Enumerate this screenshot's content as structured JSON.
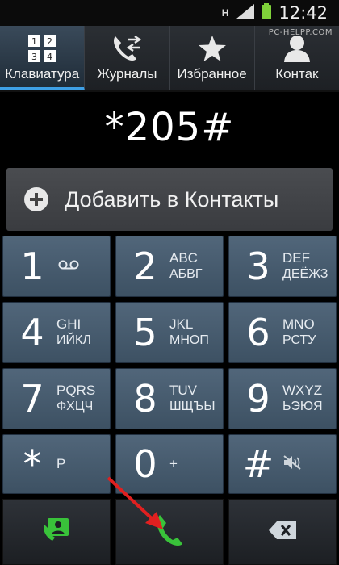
{
  "status": {
    "h_label": "H",
    "time": "12:42"
  },
  "watermark": "PC-HELPP.COM",
  "tabs": [
    {
      "label": "Клавиатура",
      "icon": "keypad-icon",
      "active": true
    },
    {
      "label": "Журналы",
      "icon": "call-log-icon"
    },
    {
      "label": "Избранное",
      "icon": "star-icon"
    },
    {
      "label": "Контак",
      "icon": "contact-person-icon"
    }
  ],
  "dialed_number": "*205#",
  "add_contact_label": "Добавить в Контакты",
  "keys": [
    {
      "digit": "1",
      "top": "",
      "bottom": ""
    },
    {
      "digit": "2",
      "top": "ABC",
      "bottom": "АБВГ"
    },
    {
      "digit": "3",
      "top": "DEF",
      "bottom": "ДЕЁЖЗ"
    },
    {
      "digit": "4",
      "top": "GHI",
      "bottom": "ИЙКЛ"
    },
    {
      "digit": "5",
      "top": "JKL",
      "bottom": "МНОП"
    },
    {
      "digit": "6",
      "top": "MNO",
      "bottom": "РСТУ"
    },
    {
      "digit": "7",
      "top": "PQRS",
      "bottom": "ФХЦЧ"
    },
    {
      "digit": "8",
      "top": "TUV",
      "bottom": "ШЩЪЫ"
    },
    {
      "digit": "9",
      "top": "WXYZ",
      "bottom": "ЬЭЮЯ"
    },
    {
      "digit": "*",
      "top": "P",
      "bottom": ""
    },
    {
      "digit": "0",
      "top": "+",
      "bottom": ""
    },
    {
      "digit": "#",
      "top": "",
      "bottom": ""
    }
  ],
  "colors": {
    "accent": "#3ea0e6",
    "call_green": "#39c23a",
    "arrow_red": "#e02020"
  }
}
